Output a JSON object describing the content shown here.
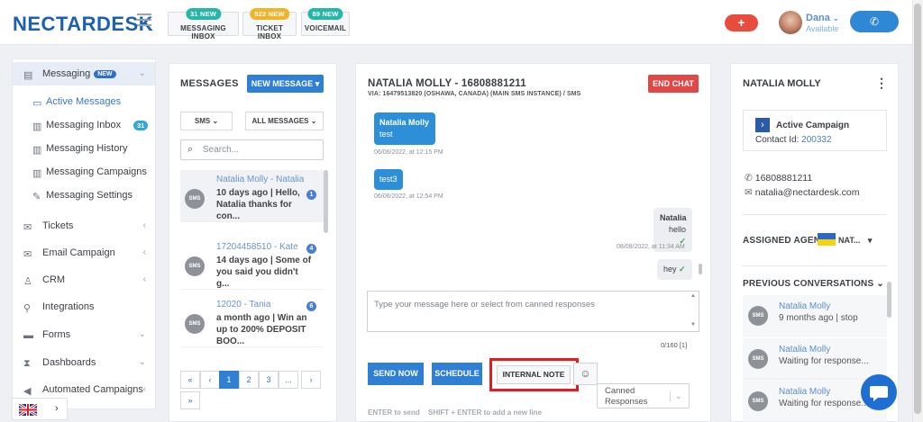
{
  "app": {
    "logo": "NECTARDESK"
  },
  "header": {
    "inboxes": [
      {
        "label": "MESSAGING INBOX",
        "badge": "31 NEW",
        "badge_color": "#26b7a8"
      },
      {
        "label": "TICKET INBOX",
        "badge": "522 NEW",
        "badge_color": "#f0b429"
      },
      {
        "label": "VOICEMAIL",
        "badge": "89 NEW",
        "badge_color": "#26b7a8"
      }
    ],
    "plus_label": "+",
    "user": {
      "name": "Dana",
      "status": "Available"
    }
  },
  "sidebar": {
    "messaging": {
      "label": "Messaging",
      "badge": "NEW"
    },
    "sub": [
      {
        "label": "Active Messages"
      },
      {
        "label": "Messaging Inbox",
        "count": "31"
      },
      {
        "label": "Messaging History"
      },
      {
        "label": "Messaging Campaigns"
      },
      {
        "label": "Messaging Settings"
      }
    ],
    "items": [
      {
        "label": "Tickets"
      },
      {
        "label": "Email Campaign"
      },
      {
        "label": "CRM"
      },
      {
        "label": "Integrations"
      },
      {
        "label": "Forms"
      },
      {
        "label": "Dashboards"
      },
      {
        "label": "Automated Campaigns"
      }
    ]
  },
  "messages": {
    "title": "MESSAGES",
    "new_button": "NEW MESSAGE",
    "filter_channel": "SMS",
    "filter_messages": "ALL MESSAGES",
    "search_placeholder": "Search...",
    "conversations": [
      {
        "title": "Natalia Molly - Natalia",
        "preview": "10 days ago | Hello, Natalia thanks for con...",
        "count": "1",
        "icon": "SMS"
      },
      {
        "title": "17204458510 - Kate",
        "preview": "14 days ago | Some of you said you didn't g...",
        "count": "4",
        "icon": "SMS"
      },
      {
        "title": "12020 - Tania",
        "preview": "a month ago | Win an up to 200% DEPOSIT BOO...",
        "count": "6",
        "icon": "SMS"
      }
    ],
    "pagination": [
      "«",
      "‹",
      "1",
      "2",
      "3",
      "...",
      "›",
      "»"
    ]
  },
  "chat": {
    "title": "NATALIA MOLLY - 16808881211",
    "via": "VIA: 16479513820 (OSHAWA, CANADA) (MAIN SMS INSTANCE) / SMS",
    "end_button": "END CHAT",
    "messages": [
      {
        "sender": "Natalia Molly",
        "text": "test",
        "time": "06/06/2022, at 12:15 PM"
      },
      {
        "text": "test3",
        "time": "06/06/2022, at 12:54 PM"
      },
      {
        "sender": "Natalia",
        "text": "hello",
        "time": "08/08/2022, at 11:34 AM"
      },
      {
        "text": "hey"
      }
    ],
    "input_placeholder": "Type your message here or select from canned responses",
    "char_count": "0/160 [1]",
    "buttons": {
      "send": "SEND NOW",
      "schedule": "SCHEDULE",
      "note": "INTERNAL NOTE",
      "emoji": "☺"
    },
    "canned_label": "Canned Responses",
    "hint_send": "ENTER to send",
    "hint_newline": "SHIFT + ENTER to add a new line"
  },
  "contact": {
    "name": "NATALIA MOLLY",
    "campaign_title": "Active Campaign",
    "contact_id_label": "Contact Id:",
    "contact_id": "200332",
    "phone": "16808881211",
    "email": "natalia@nectardesk.com",
    "assigned_label": "ASSIGNED AGEN",
    "assigned_value": "NAT...",
    "prev_label": "PREVIOUS CONVERSATIONS",
    "previous": [
      {
        "name": "Natalia Molly",
        "detail": "9 months ago | stop"
      },
      {
        "name": "Natalia Molly",
        "detail": "Waiting for response..."
      },
      {
        "name": "Natalia Molly",
        "detail": "Waiting for response..."
      }
    ]
  },
  "colors": {
    "primary": "#2f80d4",
    "danger": "#e04848",
    "highlight_box": "#e31b23"
  }
}
